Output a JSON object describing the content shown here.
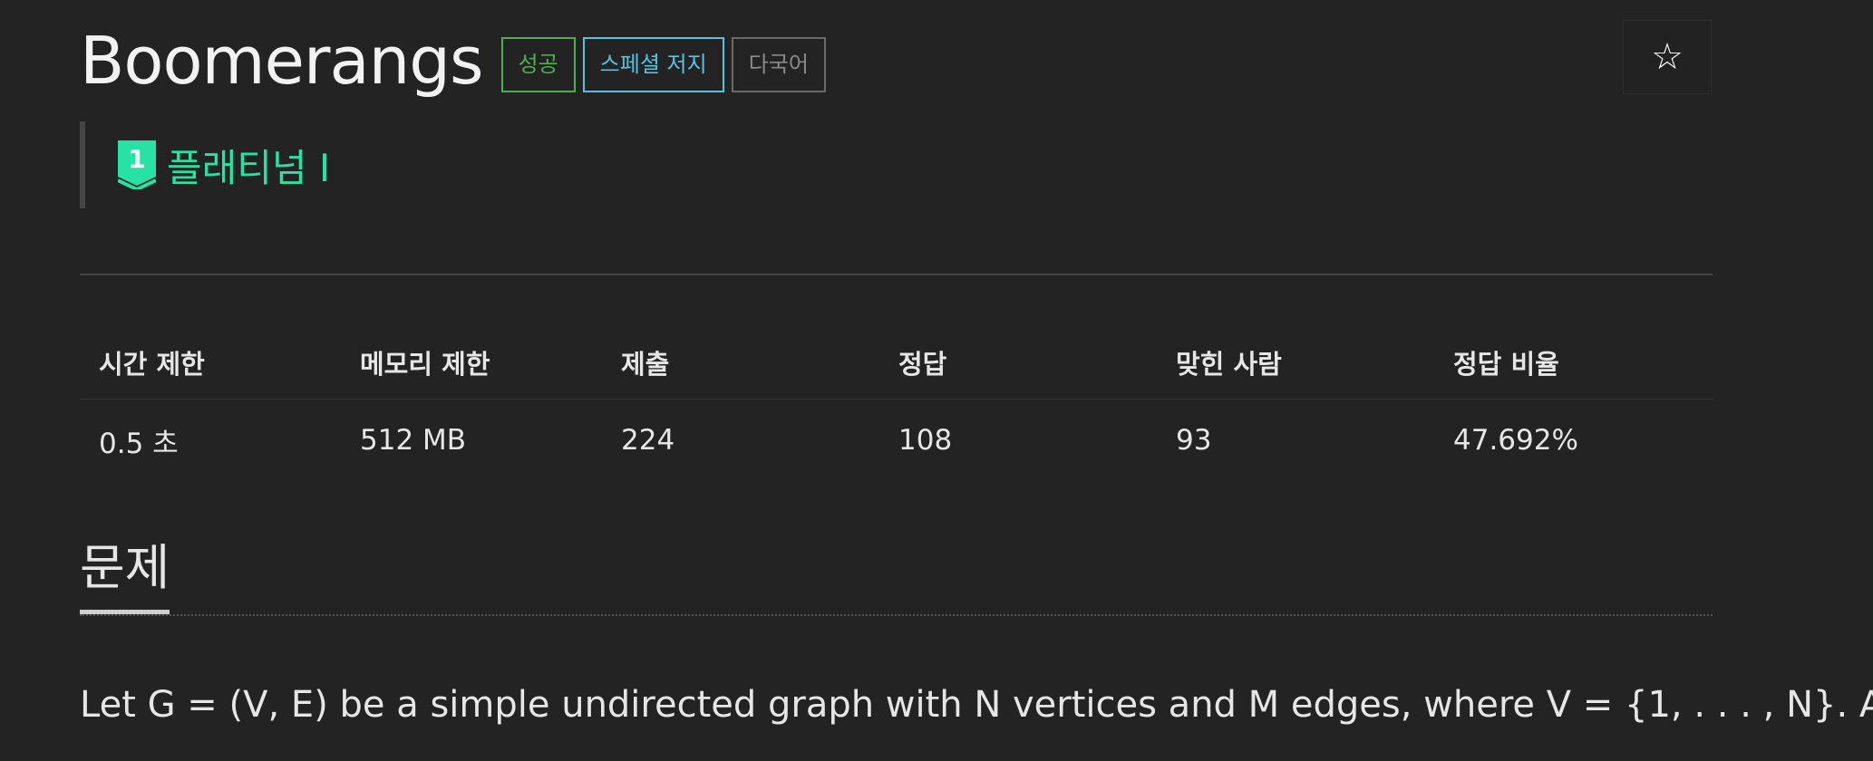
{
  "problem": {
    "title": "Boomerangs",
    "labels": {
      "success": "성공",
      "special_judge": "스페셜 저지",
      "multilang": "다국어"
    },
    "star_icon": "☆"
  },
  "tier": {
    "icon": "platinum-tier-icon",
    "icon_number": "1",
    "name": "플래티넘 I",
    "color": "#27e2a4"
  },
  "info_table": {
    "headers": [
      "시간 제한",
      "메모리 제한",
      "제출",
      "정답",
      "맞힌 사람",
      "정답 비율"
    ],
    "values": [
      "0.5 초",
      "512 MB",
      "224",
      "108",
      "93",
      "47.692%"
    ]
  },
  "section": {
    "title": "문제"
  },
  "description": {
    "line1": "Let G = (V, E) be a simple undirected graph with N vertices and M edges, where V = {1, . . . , N}. A"
  },
  "colors": {
    "background": "#232323",
    "success": "#4caf50",
    "special": "#5bc0de",
    "multilang": "#8a8a8a"
  }
}
